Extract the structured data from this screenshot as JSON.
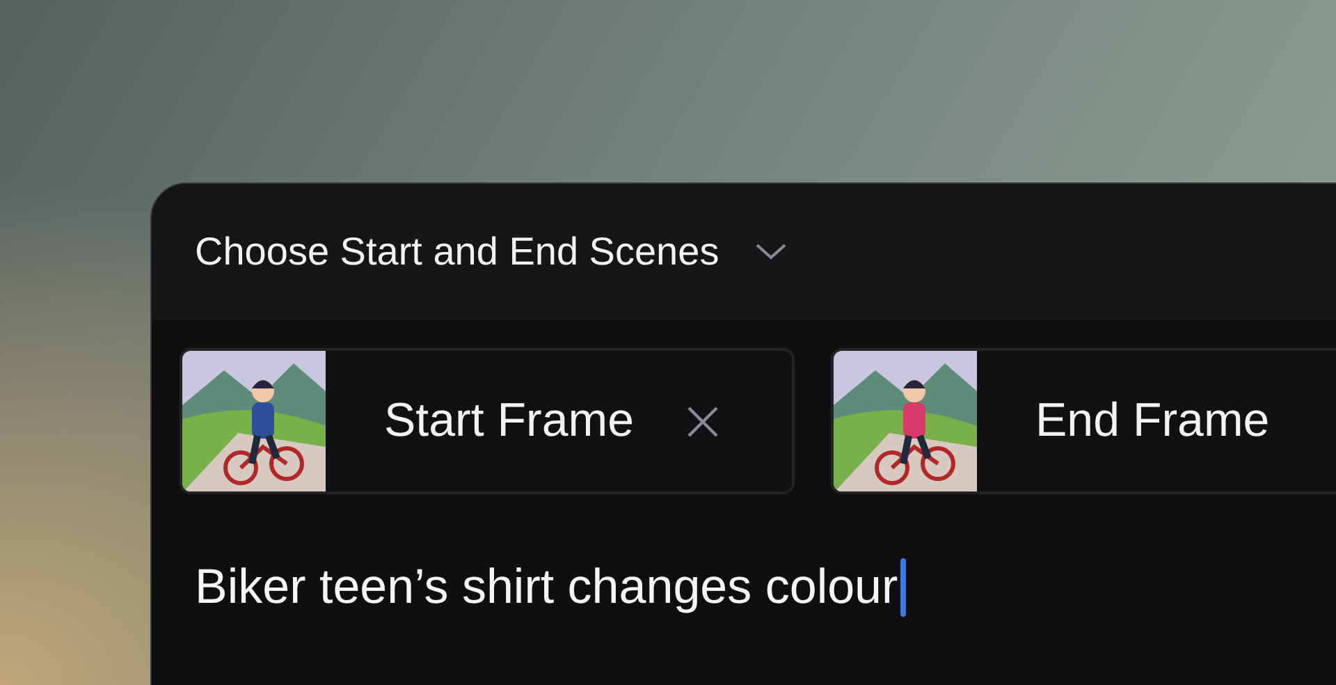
{
  "panel": {
    "title": "Choose Start and End Scenes"
  },
  "frames": [
    {
      "label": "Start Frame",
      "removable": true
    },
    {
      "label": "End Frame",
      "removable": false
    }
  ],
  "prompt": {
    "value": "Biker teen’s shirt changes colour"
  }
}
